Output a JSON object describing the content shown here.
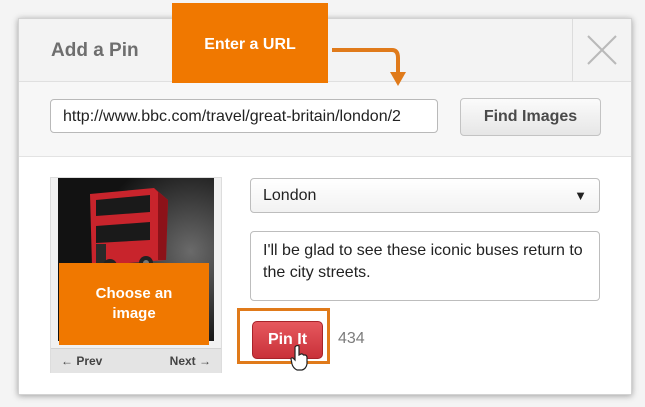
{
  "dialog": {
    "title": "Add a Pin",
    "close_icon": "close-icon"
  },
  "url_row": {
    "url_value": "http://www.bbc.com/travel/great-britain/london/2",
    "find_button": "Find Images"
  },
  "image_picker": {
    "prev_label": "← Prev",
    "next_label": "Next →"
  },
  "pin_form": {
    "board_value": "London",
    "description": "I'll be glad to see these iconic buses return to the city streets.",
    "pin_button": "Pin It",
    "pin_count": "434"
  },
  "callouts": {
    "url": "Enter a URL",
    "image": "Choose an image"
  },
  "colors": {
    "callout_orange": "#f07800",
    "pin_red": "#cf3a41",
    "highlight_orange": "#e07a1a"
  }
}
